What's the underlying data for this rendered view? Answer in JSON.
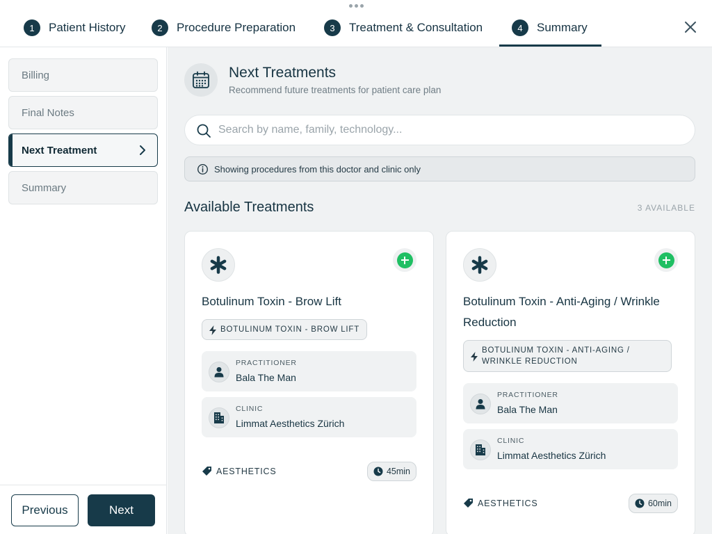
{
  "steps": [
    {
      "number": "1",
      "label": "Patient History"
    },
    {
      "number": "2",
      "label": "Procedure Preparation"
    },
    {
      "number": "3",
      "label": "Treatment & Consultation"
    },
    {
      "number": "4",
      "label": "Summary"
    }
  ],
  "active_step": "Summary",
  "sidebar": {
    "items": [
      {
        "label": "Billing"
      },
      {
        "label": "Final Notes"
      },
      {
        "label": "Next Treatment"
      },
      {
        "label": "Summary"
      }
    ],
    "active_item": "Next Treatment",
    "previous_label": "Previous",
    "next_label": "Next"
  },
  "main": {
    "title": "Next Treatments",
    "subtitle": "Recommend future treatments for patient care plan",
    "search_placeholder": "Search by name, family, technology...",
    "info_text": "Showing procedures from this doctor and clinic only",
    "section_title": "Available Treatments",
    "available_count": "3 AVAILABLE"
  },
  "cards": [
    {
      "name": "Botulinum Toxin - Brow Lift",
      "tag": "BOTULINUM TOXIN - BROW LIFT",
      "practitioner_label": "PRACTITIONER",
      "practitioner": "Bala The Man",
      "clinic_label": "CLINIC",
      "clinic": "Limmat Aesthetics Zürich",
      "category": "AESTHETICS",
      "duration": "45min"
    },
    {
      "name": "Botulinum Toxin - Anti-Aging / Wrinkle Reduction",
      "tag": "BOTULINUM TOXIN - ANTI-AGING / WRINKLE REDUCTION",
      "practitioner_label": "PRACTITIONER",
      "practitioner": "Bala The Man",
      "clinic_label": "CLINIC",
      "clinic": "Limmat Aesthetics Zürich",
      "category": "AESTHETICS",
      "duration": "60min"
    }
  ],
  "icons": {
    "header": "calendar-icon",
    "procedure": "asterisk-icon",
    "add": "plus-circle-icon",
    "practitioner": "person-icon",
    "clinic": "building-icon",
    "category": "tag-icon",
    "duration": "clock-icon",
    "tag": "bolt-icon"
  },
  "colors": {
    "primary": "#173a49",
    "add_green": "#1fbf63",
    "background": "#f0f2f3"
  }
}
